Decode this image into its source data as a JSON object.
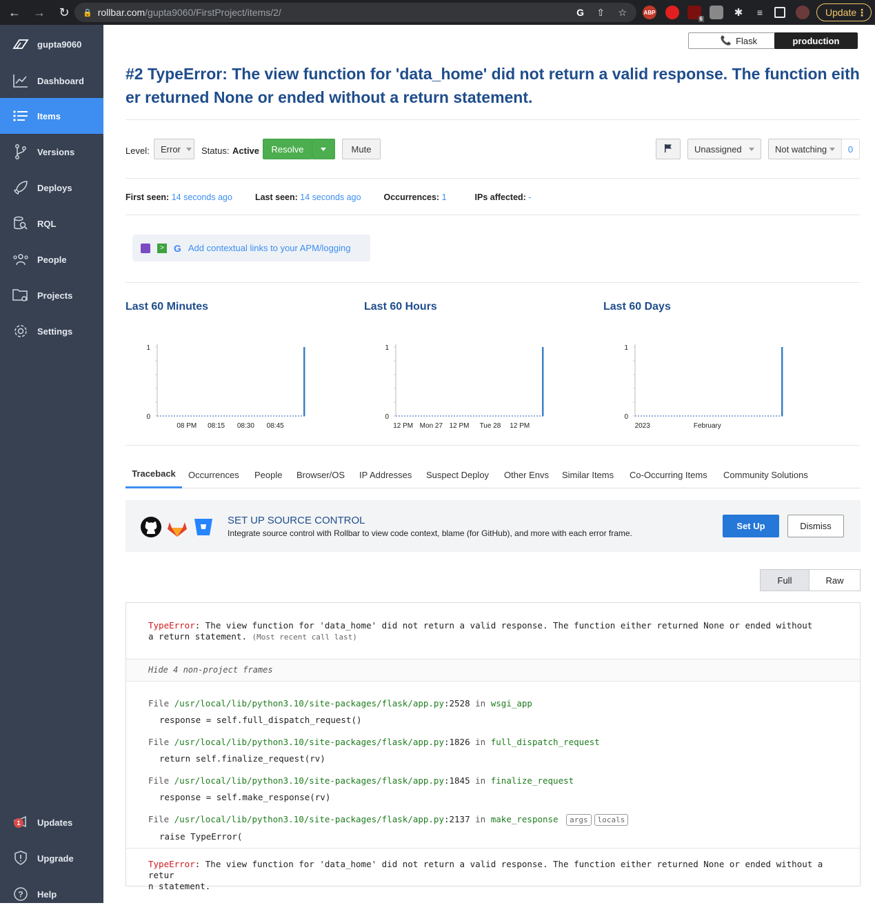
{
  "browser": {
    "url_host": "rollbar.com",
    "url_path": "/gupta9060/FirstProject/items/2/",
    "update_label": "Update",
    "ext_badge": "6",
    "ext_abp": "ABP"
  },
  "sidebar": {
    "account": "gupta9060",
    "items": [
      {
        "label": "Dashboard",
        "icon": "chart-line-icon"
      },
      {
        "label": "Items",
        "icon": "list-icon"
      },
      {
        "label": "Versions",
        "icon": "branch-icon"
      },
      {
        "label": "Deploys",
        "icon": "rocket-icon"
      },
      {
        "label": "RQL",
        "icon": "database-search-icon"
      },
      {
        "label": "People",
        "icon": "people-icon"
      },
      {
        "label": "Projects",
        "icon": "folder-gear-icon"
      },
      {
        "label": "Settings",
        "icon": "gear-icon"
      }
    ],
    "bottom": [
      {
        "label": "Updates",
        "badge": "1"
      },
      {
        "label": "Upgrade"
      },
      {
        "label": "Help"
      }
    ],
    "active_color": "#3d8ef0",
    "bg_color": "#374152"
  },
  "header": {
    "framework": "Flask",
    "environment": "production",
    "title": "#2 TypeError: The view function for 'data_home' did not return a valid response. The function either returned None or ended without a return statement."
  },
  "controls": {
    "level_label": "Level:",
    "level_value": "Error",
    "status_label": "Status:",
    "status_value": "Active",
    "resolve_label": "Resolve",
    "mute_label": "Mute",
    "assignee": "Unassigned",
    "watching": "Not watching",
    "watch_count": "0"
  },
  "stats": {
    "first_seen_label": "First seen:",
    "first_seen": "14 seconds ago",
    "last_seen_label": "Last seen:",
    "last_seen": "14 seconds ago",
    "occurrences_label": "Occurrences:",
    "occurrences": "1",
    "ips_label": "IPs affected:",
    "ips": "-"
  },
  "apm_link": "Add contextual links to your APM/logging",
  "chart_data": [
    {
      "type": "bar",
      "title": "Last 60 Minutes",
      "x_ticks": [
        "08 PM",
        "08:15",
        "08:30",
        "08:45"
      ],
      "ylim": [
        0,
        1
      ],
      "y_ticks": [
        "1",
        "0"
      ],
      "values_note": "spike at end",
      "series": [
        {
          "values": [
            0,
            0,
            0,
            0,
            0,
            0,
            0,
            0,
            0,
            0,
            0,
            0,
            0,
            0,
            0,
            0,
            0,
            0,
            0,
            0,
            0,
            0,
            0,
            0,
            0,
            0,
            0,
            0,
            0,
            0,
            0,
            0,
            0,
            0,
            0,
            0,
            0,
            0,
            0,
            0,
            0,
            0,
            0,
            0,
            0,
            0,
            0,
            0,
            0,
            0,
            0,
            0,
            0,
            0,
            0,
            0,
            0,
            0,
            0,
            1
          ]
        }
      ]
    },
    {
      "type": "bar",
      "title": "Last 60 Hours",
      "x_ticks": [
        "12 PM",
        "Mon 27",
        "12 PM",
        "Tue 28",
        "12 PM"
      ],
      "ylim": [
        0,
        1
      ],
      "y_ticks": [
        "1",
        "0"
      ],
      "series": [
        {
          "values": [
            0,
            0,
            0,
            0,
            0,
            0,
            0,
            0,
            0,
            0,
            0,
            0,
            0,
            0,
            0,
            0,
            0,
            0,
            0,
            0,
            0,
            0,
            0,
            0,
            0,
            0,
            0,
            0,
            0,
            0,
            0,
            0,
            0,
            0,
            0,
            0,
            0,
            0,
            0,
            0,
            0,
            0,
            0,
            0,
            0,
            0,
            0,
            0,
            0,
            0,
            0,
            0,
            0,
            0,
            0,
            0,
            0,
            0,
            0,
            1
          ]
        }
      ]
    },
    {
      "type": "bar",
      "title": "Last 60 Days",
      "x_ticks": [
        "2023",
        "February"
      ],
      "ylim": [
        0,
        1
      ],
      "y_ticks": [
        "1",
        "0"
      ],
      "series": [
        {
          "values": [
            0,
            0,
            0,
            0,
            0,
            0,
            0,
            0,
            0,
            0,
            0,
            0,
            0,
            0,
            0,
            0,
            0,
            0,
            0,
            0,
            0,
            0,
            0,
            0,
            0,
            0,
            0,
            0,
            0,
            0,
            0,
            0,
            0,
            0,
            0,
            0,
            0,
            0,
            0,
            0,
            0,
            0,
            0,
            0,
            0,
            0,
            0,
            0,
            0,
            0,
            0,
            0,
            0,
            0,
            0,
            0,
            0,
            0,
            0,
            1
          ]
        }
      ]
    }
  ],
  "tabs": [
    "Traceback",
    "Occurrences",
    "People",
    "Browser/OS",
    "IP Addresses",
    "Suspect Deploy",
    "Other Envs",
    "Similar Items",
    "Co-Occurring Items",
    "Community Solutions"
  ],
  "source_control": {
    "title": "SET UP SOURCE CONTROL",
    "desc": "Integrate source control with Rollbar to view code context, blame (for GitHub), and more with each error frame.",
    "setup_label": "Set Up",
    "dismiss_label": "Dismiss"
  },
  "view_toggle": {
    "full": "Full",
    "raw": "Raw"
  },
  "traceback": {
    "err_type": "TypeError",
    "err_msg_line1": ": The view function for 'data_home' did not return a valid response. The function either returned None or ended without",
    "err_msg_line2": "a return statement.",
    "recent_note": "(Most recent call last)",
    "hide_frames": "Hide 4 non-project frames",
    "file_word": "File",
    "in_word": "in",
    "frames": [
      {
        "path": "/usr/local/lib/python3.10/site-packages/flask/app.py",
        "line": ":2528",
        "func": "wsgi_app",
        "code": "response = self.full_dispatch_request()"
      },
      {
        "path": "/usr/local/lib/python3.10/site-packages/flask/app.py",
        "line": ":1826",
        "func": "full_dispatch_request",
        "code": "return self.finalize_request(rv)"
      },
      {
        "path": "/usr/local/lib/python3.10/site-packages/flask/app.py",
        "line": ":1845",
        "func": "finalize_request",
        "code": "response = self.make_response(rv)"
      },
      {
        "path": "/usr/local/lib/python3.10/site-packages/flask/app.py",
        "line": ":2137",
        "func": "make_response",
        "code": "raise TypeError("
      }
    ],
    "pill_args": "args",
    "pill_locals": "locals",
    "final_line1": ": The view function for 'data_home' did not return a valid response. The function either returned None or ended without a retur",
    "final_line2": "n statement."
  }
}
